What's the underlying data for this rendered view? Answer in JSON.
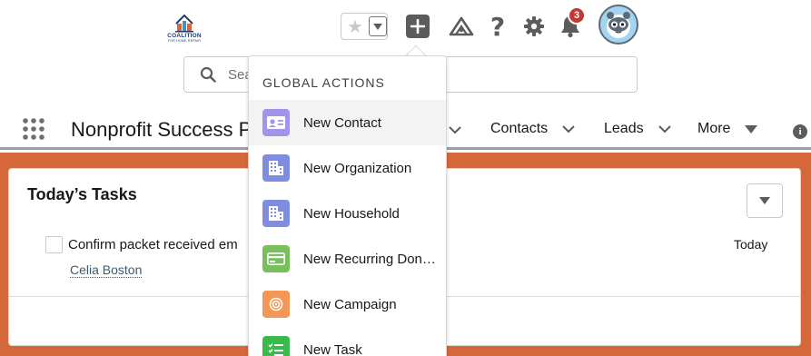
{
  "header": {
    "logo": {
      "name": "COALITION",
      "sub": "FOR HOME REPAIR"
    },
    "notification_count": "3",
    "search": {
      "placeholder": "Sea"
    }
  },
  "nav": {
    "app_name": "Nonprofit Success P",
    "items": [
      {
        "label": "Contacts"
      },
      {
        "label": "Leads"
      },
      {
        "label": "More"
      }
    ]
  },
  "card": {
    "title": "Today’s Tasks",
    "task": {
      "subject": "Confirm packet received em",
      "who": "Celia Boston",
      "date": "Today"
    }
  },
  "global_actions": {
    "header": "GLOBAL ACTIONS",
    "items": [
      {
        "label": "New Contact",
        "color": "#a094ed",
        "icon": "contact-card-icon"
      },
      {
        "label": "New Organization",
        "color": "#7f8de1",
        "icon": "building-icon"
      },
      {
        "label": "New Household",
        "color": "#7f8de1",
        "icon": "building-icon"
      },
      {
        "label": "New Recurring Don…",
        "color": "#78c05c",
        "icon": "credit-card-icon"
      },
      {
        "label": "New Campaign",
        "color": "#f49756",
        "icon": "target-icon"
      },
      {
        "label": "New Task",
        "color": "#3bba4c",
        "icon": "task-list-icon"
      }
    ]
  },
  "colors": {
    "page_background": "#d4683a",
    "notification_badge": "#c23934"
  }
}
